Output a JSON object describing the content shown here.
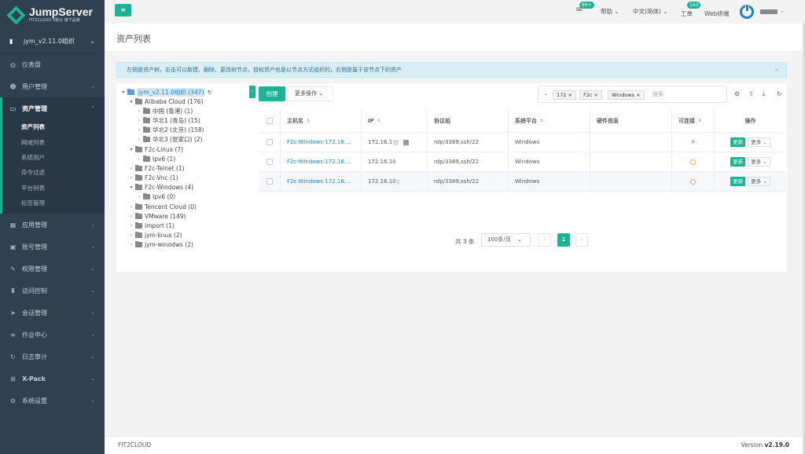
{
  "brand": {
    "name": "JumpServer",
    "tagline": "FIT2CLOUD飞致云 旗下品牌",
    "color": "#1ab394"
  },
  "sidebar": {
    "org": "jym_v2.11.0组织",
    "items": [
      {
        "label": "仪表盘",
        "icon": "dashboard-icon"
      },
      {
        "label": "用户管理",
        "icon": "users-icon"
      },
      {
        "label": "资产管理",
        "icon": "inbox-icon"
      },
      {
        "label": "应用管理",
        "icon": "grid-icon"
      },
      {
        "label": "账号管理",
        "icon": "account-icon"
      },
      {
        "label": "权限管理",
        "icon": "edit-icon"
      },
      {
        "label": "访问控制",
        "icon": "access-icon"
      },
      {
        "label": "会话管理",
        "icon": "send-icon"
      },
      {
        "label": "作业中心",
        "icon": "job-icon"
      },
      {
        "label": "日志审计",
        "icon": "history-icon"
      },
      {
        "label": "X-Pack",
        "icon": "sitemap-icon"
      },
      {
        "label": "系统设置",
        "icon": "gears-icon"
      }
    ],
    "asset_sub": [
      "资产列表",
      "网域列表",
      "系统用户",
      "命令过滤",
      "平台列表",
      "标签管理"
    ]
  },
  "topbar": {
    "mail_badge": "99+",
    "help": "帮助",
    "lang": "中文(简体)",
    "ticket": "工单",
    "ticket_badge": "193",
    "web_terminal": "Web终端"
  },
  "page": {
    "title": "资产列表",
    "info": "左侧是资产树，右击可以新建、删除、更改树节点，授权资产也是以节点方式组织的，右侧是属于该节点下的资产",
    "info_close": "×"
  },
  "tree": [
    {
      "label": "jym_v2.11.0组织 (347)",
      "root": true
    },
    {
      "label": "Alibaba Cloud (176)"
    },
    {
      "label": "中国 (香港) (1)"
    },
    {
      "label": "华北1 (青岛) (15)"
    },
    {
      "label": "华北2 (北京) (158)"
    },
    {
      "label": "华北3 (张家口) (2)"
    },
    {
      "label": "F2c-Linux (7)"
    },
    {
      "label": "Ipv6 (1)"
    },
    {
      "label": "F2c-Telnet (1)"
    },
    {
      "label": "F2c-Vnc (1)"
    },
    {
      "label": "F2c-Windows (4)"
    },
    {
      "label": "Ipv6 (0)"
    },
    {
      "label": "Tencent Cloud (0)"
    },
    {
      "label": "VMware (149)"
    },
    {
      "label": "import (1)"
    },
    {
      "label": "jym-linux (2)"
    },
    {
      "label": "jym-winodws (2)"
    }
  ],
  "toolbar": {
    "create": "创建",
    "more_actions": "更多操作",
    "search_tags": [
      "172",
      "F2c",
      "Windows"
    ],
    "search_placeholder": "搜索"
  },
  "table": {
    "headers": [
      "主机名",
      "IP",
      "协议组",
      "系统平台",
      "硬件信息",
      "可连接",
      "操作"
    ],
    "rows": [
      {
        "hostname": "F2c-Windows-172.16....",
        "ip": "172.16.1",
        "protocols": "rdp/3389,ssh/22",
        "platform": "Windows",
        "hardware": "",
        "status": "failed"
      },
      {
        "hostname": "F2c-Windows-172.16....",
        "ip": "172.16.10",
        "protocols": "rdp/3389,ssh/22",
        "platform": "Windows",
        "hardware": "",
        "status": "unknown"
      },
      {
        "hostname": "F2c-Windows-172.16....",
        "ip": "172.16.10",
        "protocols": "rdp/3389,ssh/22",
        "platform": "Windows",
        "hardware": "",
        "status": "unknown"
      }
    ],
    "update_label": "更新",
    "more_label": "更多"
  },
  "pagination": {
    "total": "共 3 条",
    "page_size": "100条/页",
    "current": "1"
  },
  "footer": {
    "company": "FIT2CLOUD",
    "version_label": "Version",
    "version": "v2.19.0"
  }
}
